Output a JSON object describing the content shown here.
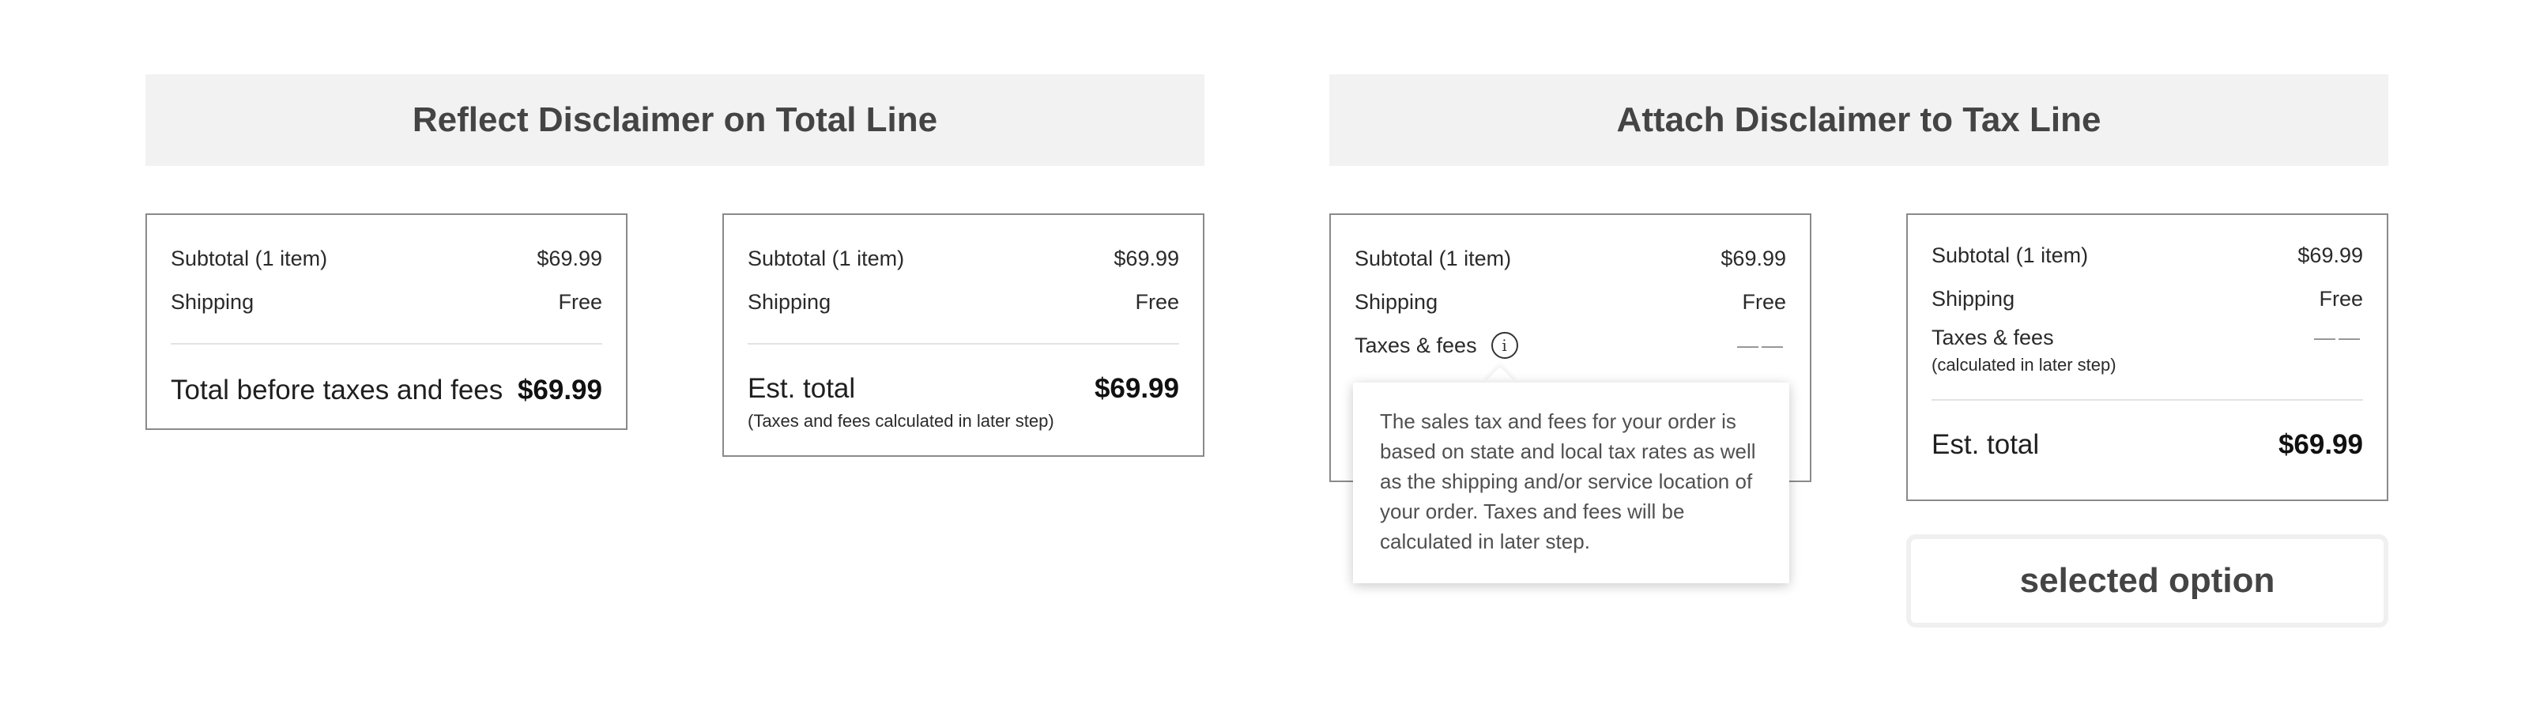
{
  "sections": {
    "left_title": "Reflect Disclaimer on Total Line",
    "right_title": "Attach Disclaimer to Tax Line"
  },
  "card_a": {
    "subtotal_label": "Subtotal (1 item)",
    "subtotal_value": "$69.99",
    "shipping_label": "Shipping",
    "shipping_value": "Free",
    "total_label": "Total before taxes and fees",
    "total_value": "$69.99"
  },
  "card_b": {
    "subtotal_label": "Subtotal (1 item)",
    "subtotal_value": "$69.99",
    "shipping_label": "Shipping",
    "shipping_value": "Free",
    "total_label": "Est. total",
    "total_value": "$69.99",
    "total_note": "(Taxes and fees calculated in later step)"
  },
  "card_c": {
    "subtotal_label": "Subtotal (1 item)",
    "subtotal_value": "$69.99",
    "shipping_label": "Shipping",
    "shipping_value": "Free",
    "taxes_label": "Taxes & fees",
    "taxes_value": "——",
    "info_icon_glyph": "i",
    "tooltip_text": "The sales tax and fees for your order is based on state and local tax rates as well as the shipping and/or service location of your order. Taxes and fees will be calculated in later step."
  },
  "card_d": {
    "subtotal_label": "Subtotal (1 item)",
    "subtotal_value": "$69.99",
    "shipping_label": "Shipping",
    "shipping_value": "Free",
    "taxes_label": "Taxes & fees",
    "taxes_sub": "(calculated in later step)",
    "taxes_value": "——",
    "total_label": "Est. total",
    "total_value": "$69.99"
  },
  "selected_label": "selected option",
  "icons": {
    "info": "info-icon"
  },
  "colors": {
    "header_bg": "#f2f2f2",
    "header_text": "#444444",
    "card_border": "#8a8a8a",
    "divider": "#e3e3e3",
    "selected_border": "#f0f0f0"
  }
}
